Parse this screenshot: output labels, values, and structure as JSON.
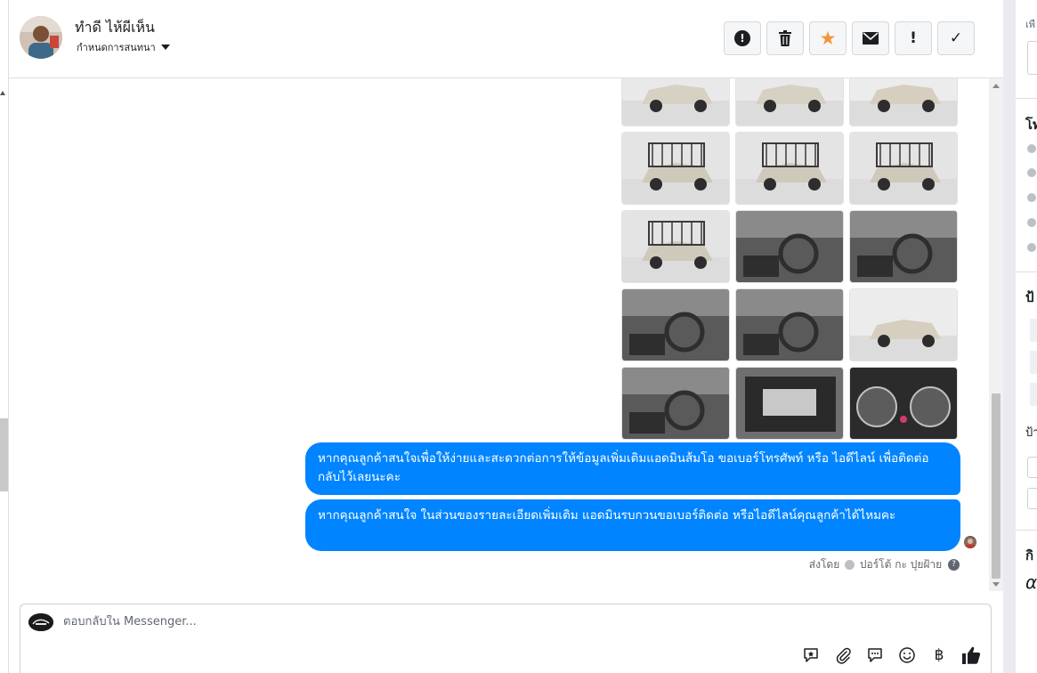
{
  "header": {
    "contact_name": "ทำดี ไห้ผีเห็น",
    "conversation_settings": "กำหนดการสนทนา",
    "actions": [
      {
        "name": "spam-icon",
        "glyph": "!"
      },
      {
        "name": "trash-icon",
        "glyph": ""
      },
      {
        "name": "star-icon",
        "glyph": "★",
        "color": "#f7923a"
      },
      {
        "name": "mail-icon",
        "glyph": ""
      },
      {
        "name": "follow-up-icon",
        "glyph": "!"
      },
      {
        "name": "done-icon",
        "glyph": "✓"
      }
    ]
  },
  "messages": {
    "bubble_1": "หากคุณลูกค้าสนใจเพื่อให้ง่ายและสะดวกต่อการให้ข้อมูลเพิ่มเติมแอดมินส้มโอ ขอเบอร์โทรศัพท์ หรือ ไอดีไลน์ เพื่อติดต่อกลับไว้เลยนะคะ",
    "bubble_2": "หากคุณลูกค้าสนใจ ในส่วนของรายละเอียดเพิ่มเติม แอดมินรบกวนขอเบอร์ติดต่อ หรือไอดีไลน์คุณลูกค้าได้ไหมคะ",
    "sent_by_label": "ส่งโดย",
    "sent_by_name": "ปอร์โต้ กะ ปุยฝ้าย",
    "accent_color": "#0084ff",
    "photos": [
      {
        "name": "photo-front-view",
        "kind": "front"
      },
      {
        "name": "photo-front-close",
        "kind": "front"
      },
      {
        "name": "photo-front-side",
        "kind": "side"
      },
      {
        "name": "photo-rear-rack-1",
        "kind": "rack"
      },
      {
        "name": "photo-rear-rack-2",
        "kind": "rack"
      },
      {
        "name": "photo-rear-rack-3",
        "kind": "rack"
      },
      {
        "name": "photo-side-rack",
        "kind": "rack"
      },
      {
        "name": "photo-gear-shift",
        "kind": "interior"
      },
      {
        "name": "photo-dashboard",
        "kind": "interior"
      },
      {
        "name": "photo-radio-panel",
        "kind": "interior"
      },
      {
        "name": "photo-driver-seat",
        "kind": "interior"
      },
      {
        "name": "photo-wheel-detail",
        "kind": "side"
      },
      {
        "name": "photo-door-panel",
        "kind": "interior"
      },
      {
        "name": "photo-engine-bay",
        "kind": "engine"
      },
      {
        "name": "photo-gauge-cluster",
        "kind": "gauge"
      }
    ]
  },
  "composer": {
    "placeholder": "ตอบกลับใน Messenger...",
    "tools": [
      "saved-reply-icon",
      "attachment-icon",
      "chat-bubble-icon",
      "emoji-icon",
      "baht-payment-icon",
      "like-icon"
    ],
    "baht_glyph": "฿"
  },
  "right_panel": {
    "snippets": [
      "เพื",
      "โท",
      "ป้",
      "ป้า",
      "กิ"
    ]
  }
}
